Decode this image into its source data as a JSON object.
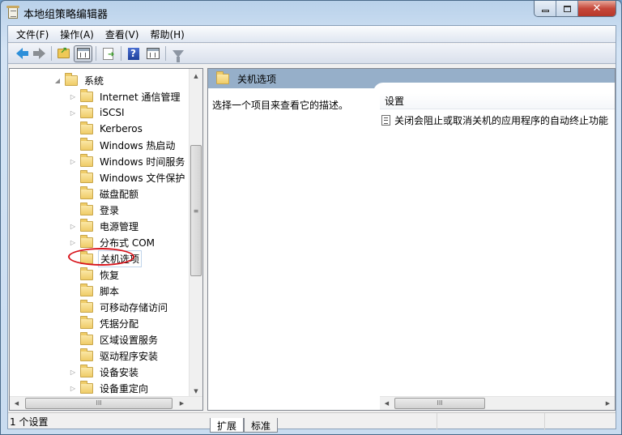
{
  "window": {
    "title": "本地组策略编辑器",
    "caption_buttons": {
      "minimize": "minimize",
      "maximize": "maximize",
      "close": "✕"
    }
  },
  "menu": [
    {
      "label": "文件(F)"
    },
    {
      "label": "操作(A)"
    },
    {
      "label": "查看(V)"
    },
    {
      "label": "帮助(H)"
    }
  ],
  "toolbar": [
    {
      "icon": "back-arrow-icon",
      "name": "back"
    },
    {
      "icon": "forward-arrow-icon",
      "name": "forward"
    },
    {
      "icon": "folder-up-icon",
      "name": "up-one-level"
    },
    {
      "icon": "show-hide-tree-icon",
      "name": "show-hide-console-tree",
      "pressed": true
    },
    {
      "icon": "export-list-icon",
      "name": "export-list"
    },
    {
      "icon": "help-icon",
      "name": "help"
    },
    {
      "icon": "action-pane-icon",
      "name": "show-hide-action-pane"
    },
    {
      "icon": "filter-icon",
      "name": "filter"
    }
  ],
  "tree": {
    "parent": {
      "label": "系统",
      "expanded": true
    },
    "items": [
      {
        "label": "Internet 通信管理",
        "has_children": true
      },
      {
        "label": "iSCSI",
        "has_children": true
      },
      {
        "label": "Kerberos",
        "has_children": false
      },
      {
        "label": "Windows 热启动",
        "has_children": false
      },
      {
        "label": "Windows 时间服务",
        "has_children": true
      },
      {
        "label": "Windows 文件保护",
        "has_children": false
      },
      {
        "label": "磁盘配额",
        "has_children": false
      },
      {
        "label": "登录",
        "has_children": false
      },
      {
        "label": "电源管理",
        "has_children": true
      },
      {
        "label": "分布式 COM",
        "has_children": true
      },
      {
        "label": "关机选项",
        "has_children": false,
        "selected": true,
        "annotated": true
      },
      {
        "label": "恢复",
        "has_children": false
      },
      {
        "label": "脚本",
        "has_children": false
      },
      {
        "label": "可移动存储访问",
        "has_children": false
      },
      {
        "label": "凭据分配",
        "has_children": false
      },
      {
        "label": "区域设置服务",
        "has_children": false
      },
      {
        "label": "驱动程序安装",
        "has_children": false
      },
      {
        "label": "设备安装",
        "has_children": true
      },
      {
        "label": "设备重定向",
        "has_children": true
      }
    ],
    "scrollbar_grip": "≡",
    "hscroll_grip": "III"
  },
  "details": {
    "header_title": "关机选项",
    "description": "选择一个项目来查看它的描述。",
    "column_header": "设置",
    "settings": [
      {
        "label": "关闭会阻止或取消关机的应用程序的自动终止功能"
      }
    ],
    "hscroll_grip": "III"
  },
  "tabs": [
    {
      "label": "扩展",
      "active": true
    },
    {
      "label": "标准",
      "active": false
    }
  ],
  "status": {
    "text": "1 个设置"
  },
  "colors": {
    "annotation_ring": "#d8141c",
    "details_header": "#96afc9"
  }
}
